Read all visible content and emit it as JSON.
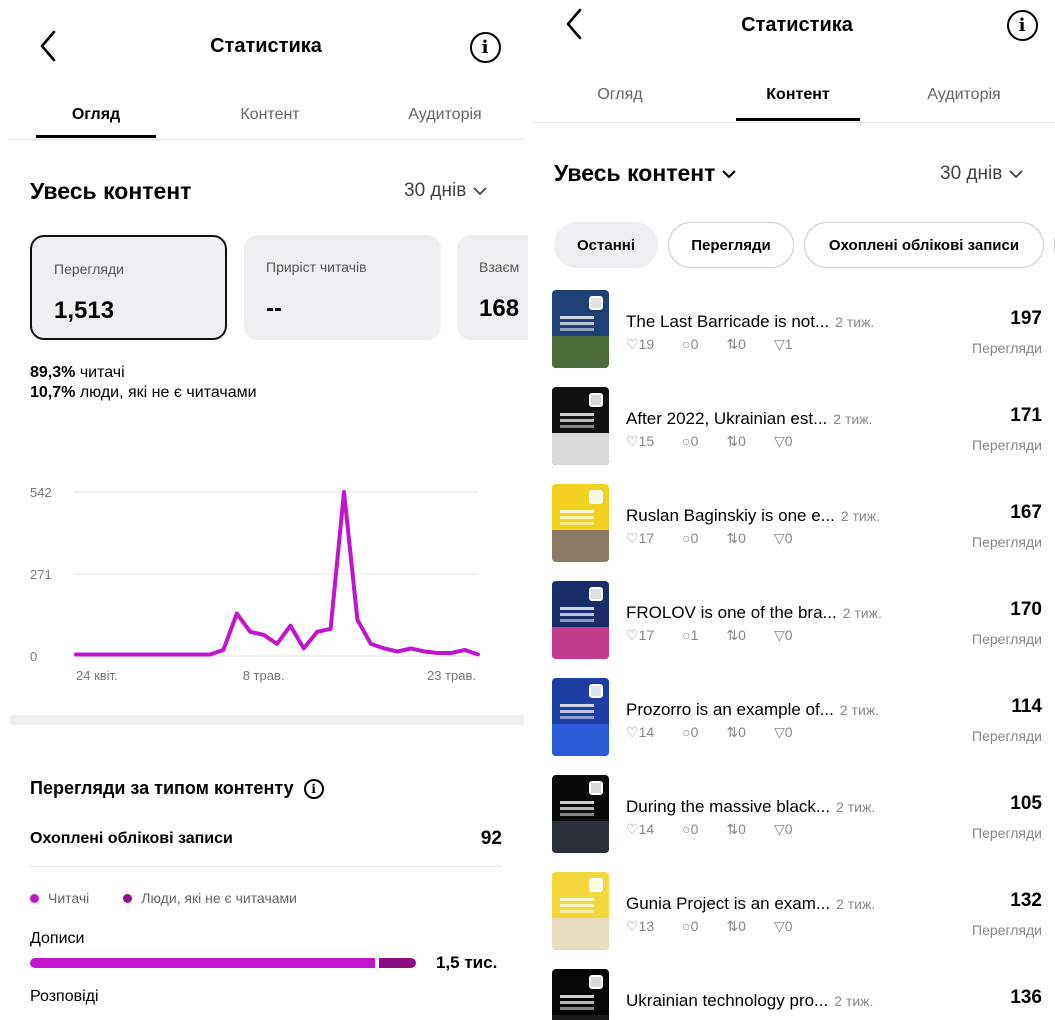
{
  "left": {
    "header": {
      "title": "Статистика"
    },
    "tabs": [
      {
        "label": "Огляд",
        "active": true
      },
      {
        "label": "Контент",
        "active": false
      },
      {
        "label": "Аудиторія",
        "active": false
      }
    ],
    "section_title": "Увесь контент",
    "period": "30 днів",
    "cards": [
      {
        "label": "Перегляди",
        "value": "1,513"
      },
      {
        "label": "Приріст читачів",
        "value": "--"
      },
      {
        "label": "Взаєм",
        "value": "168"
      }
    ],
    "followers_pct": "89,3%",
    "followers_label": "читачі",
    "nonfollowers_pct": "10,7%",
    "nonfollowers_label": "люди, які не є читачами",
    "content_type": {
      "title": "Перегляди за типом контенту",
      "accounts_label": "Охоплені облікові записи",
      "accounts_value": "92",
      "legend": [
        {
          "label": "Читачі",
          "color": "#c213cf"
        },
        {
          "label": "Люди, які не є читачами",
          "color": "#8a0e86"
        }
      ],
      "rows": [
        {
          "label": "Дописи",
          "value": "1,5 тис.",
          "followers_fraction": 0.893
        },
        {
          "label": "Розповіді",
          "value": ""
        }
      ]
    }
  },
  "chart_data": {
    "type": "line",
    "x": [
      "24 квіт.",
      "25",
      "26",
      "27",
      "28",
      "29",
      "30",
      "1",
      "2",
      "3",
      "4",
      "5",
      "6",
      "7",
      "8 трав.",
      "9",
      "10",
      "11",
      "12",
      "13",
      "14",
      "15",
      "16",
      "17",
      "18",
      "19",
      "20",
      "21",
      "22",
      "23 трав.",
      "24"
    ],
    "xticks": [
      "24 квіт.",
      "8 трав.",
      "23 трав."
    ],
    "yticks": [
      "0",
      "271",
      "542"
    ],
    "series": [
      {
        "values": [
          5,
          5,
          5,
          5,
          5,
          5,
          5,
          5,
          5,
          5,
          5,
          20,
          140,
          80,
          70,
          40,
          100,
          25,
          80,
          90,
          542,
          120,
          40,
          25,
          15,
          25,
          15,
          10,
          10,
          20,
          5
        ]
      }
    ],
    "ylim": [
      0,
      542
    ],
    "grid": true,
    "color": "#c213cf"
  },
  "right": {
    "header": {
      "title": "Статистика"
    },
    "tabs": [
      {
        "label": "Огляд",
        "active": false
      },
      {
        "label": "Контент",
        "active": true
      },
      {
        "label": "Аудиторія",
        "active": false
      }
    ],
    "section_title": "Увесь контент",
    "period": "30 днів",
    "pills": [
      {
        "label": "Останні",
        "active": true
      },
      {
        "label": "Перегляди",
        "active": false
      },
      {
        "label": "Охоплені облікові записи",
        "active": false
      }
    ],
    "posts": [
      {
        "title": "The Last Barricade is not...",
        "age": "2 тиж.",
        "likes": "19",
        "comments": "0",
        "reposts": "0",
        "shares": "1",
        "value": "197",
        "unit": "Перегляди",
        "thumb_color": "#1f3f76",
        "band_color": "#4a6b3a"
      },
      {
        "title": "After 2022, Ukrainian est...",
        "age": "2 тиж.",
        "likes": "15",
        "comments": "0",
        "reposts": "0",
        "shares": "0",
        "value": "171",
        "unit": "Перегляди",
        "thumb_color": "#111111",
        "band_color": "#d9d9d9"
      },
      {
        "title": "Ruslan Baginskiy is one e...",
        "age": "2 тиж.",
        "likes": "17",
        "comments": "0",
        "reposts": "0",
        "shares": "0",
        "value": "167",
        "unit": "Перегляди",
        "thumb_color": "#f2d21e",
        "band_color": "#8a7a66"
      },
      {
        "title": "FROLOV is one of the bra...",
        "age": "2 тиж.",
        "likes": "17",
        "comments": "1",
        "reposts": "0",
        "shares": "0",
        "value": "170",
        "unit": "Перегляди",
        "thumb_color": "#1b2c6b",
        "band_color": "#c23d8b"
      },
      {
        "title": "Prozorro is an example of...",
        "age": "2 тиж.",
        "likes": "14",
        "comments": "0",
        "reposts": "0",
        "shares": "0",
        "value": "114",
        "unit": "Перегляди",
        "thumb_color": "#1d3ea2",
        "band_color": "#2b5ad6"
      },
      {
        "title": "During the massive black...",
        "age": "2 тиж.",
        "likes": "14",
        "comments": "0",
        "reposts": "0",
        "shares": "0",
        "value": "105",
        "unit": "Перегляди",
        "thumb_color": "#0a0a0a",
        "band_color": "#2a2f3a"
      },
      {
        "title": "Gunia Project is an exam...",
        "age": "2 тиж.",
        "likes": "13",
        "comments": "0",
        "reposts": "0",
        "shares": "0",
        "value": "132",
        "unit": "Перегляди",
        "thumb_color": "#f4d83b",
        "band_color": "#e8dcc0"
      },
      {
        "title": "Ukrainian technology pro...",
        "age": "2 тиж.",
        "likes": "",
        "comments": "",
        "reposts": "",
        "shares": "",
        "value": "136",
        "unit": "",
        "thumb_color": "#050505",
        "band_color": "#1a1a1a"
      }
    ]
  }
}
